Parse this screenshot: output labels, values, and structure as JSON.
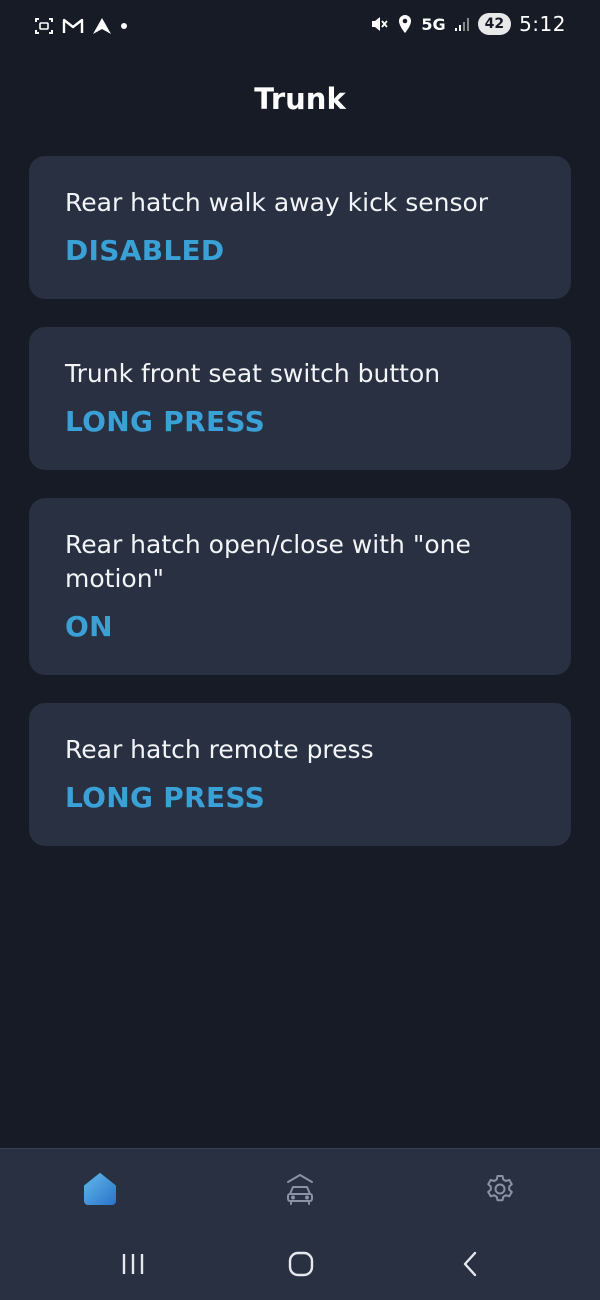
{
  "status_bar": {
    "network": "5G",
    "battery": "42",
    "time": "5:12"
  },
  "page": {
    "title": "Trunk"
  },
  "settings": [
    {
      "label": "Rear hatch walk away kick sensor",
      "value": "DISABLED"
    },
    {
      "label": "Trunk front seat switch button",
      "value": "LONG PRESS"
    },
    {
      "label": "Rear hatch open/close with \"one motion\"",
      "value": "ON"
    },
    {
      "label": "Rear hatch remote press",
      "value": "LONG PRESS"
    }
  ],
  "bottom_nav": {
    "items": [
      {
        "icon": "home-icon",
        "active": true
      },
      {
        "icon": "car-garage-icon",
        "active": false
      },
      {
        "icon": "gear-icon",
        "active": false
      }
    ]
  },
  "colors": {
    "background": "#161b26",
    "card": "#283041",
    "accent": "#3aa1d6"
  }
}
